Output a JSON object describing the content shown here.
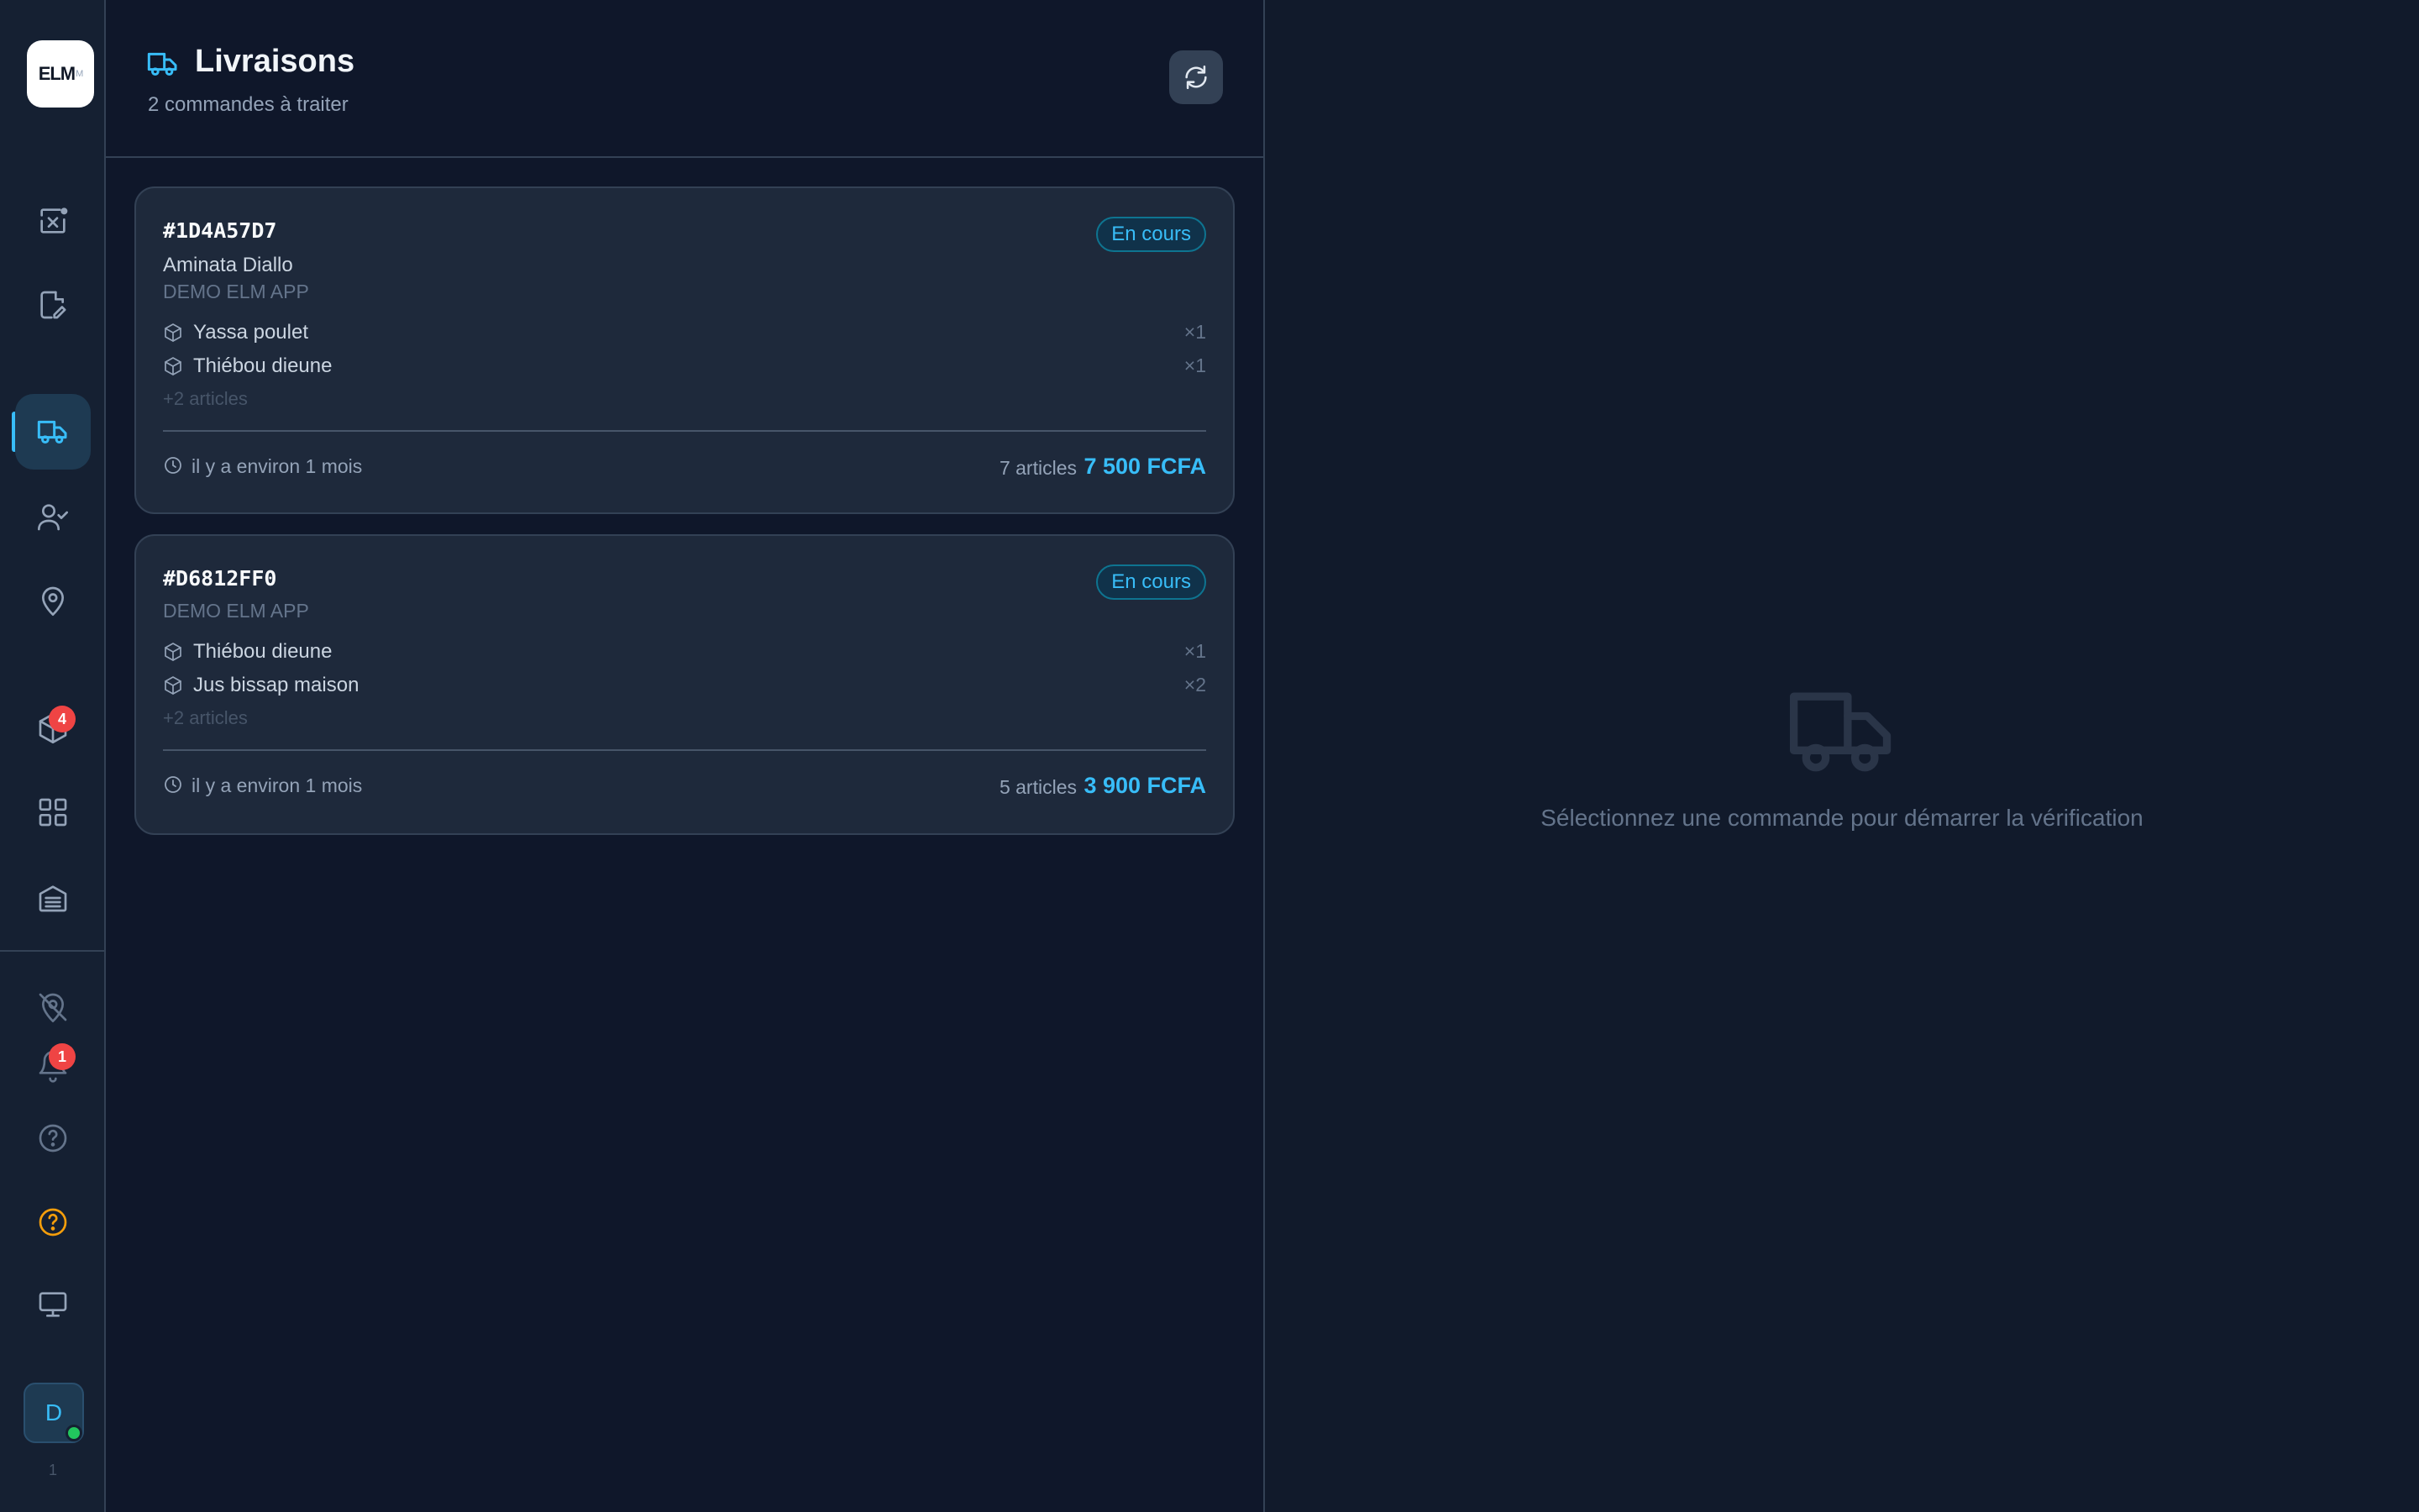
{
  "sidebar": {
    "logo_text": "ELM",
    "logo_small": "M",
    "items": [
      {
        "icon": "scan-icon"
      },
      {
        "icon": "edit-document-icon"
      },
      {
        "icon": "truck-icon",
        "active": true
      },
      {
        "icon": "user-check-icon"
      },
      {
        "icon": "map-pin-icon"
      },
      {
        "icon": "package-icon",
        "badge": "4"
      },
      {
        "icon": "grid-icon"
      },
      {
        "icon": "archive-icon"
      },
      {
        "icon": "map-pin-off-icon"
      },
      {
        "icon": "bell-icon",
        "badge": "1"
      },
      {
        "icon": "help-circle-icon"
      },
      {
        "icon": "help-circle-orange-icon"
      },
      {
        "icon": "monitor-icon"
      }
    ],
    "avatar_letter": "D",
    "version": "1"
  },
  "header": {
    "title": "Livraisons",
    "subtitle": "2 commandes à traiter"
  },
  "orders": [
    {
      "id": "#1D4A57D7",
      "status": "En cours",
      "customer": "Aminata Diallo",
      "store": "DEMO ELM APP",
      "items": [
        {
          "name": "Yassa poulet",
          "qty": "×1"
        },
        {
          "name": "Thiébou dieune",
          "qty": "×1"
        }
      ],
      "more": "+2 articles",
      "time": "il y a environ 1 mois",
      "count": "7 articles",
      "total": "7 500 FCFA"
    },
    {
      "id": "#D6812FF0",
      "status": "En cours",
      "store": "DEMO ELM APP",
      "items": [
        {
          "name": "Thiébou dieune",
          "qty": "×1"
        },
        {
          "name": "Jus bissap maison",
          "qty": "×2"
        }
      ],
      "more": "+2 articles",
      "time": "il y a environ 1 mois",
      "count": "5 articles",
      "total": "3 900 FCFA"
    }
  ],
  "detail": {
    "empty_message": "Sélectionnez une commande pour démarrer la vérification"
  },
  "colors": {
    "accent": "#38bdf8",
    "badge": "#ef4444",
    "online": "#22c55e",
    "warning": "#f59e0b"
  }
}
